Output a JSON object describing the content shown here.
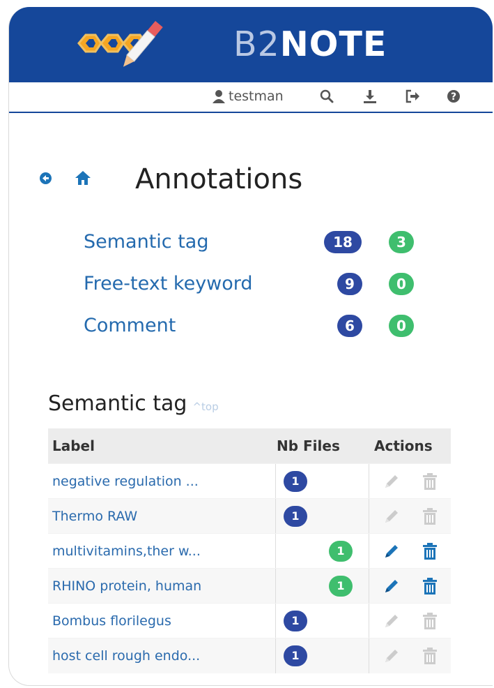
{
  "app": {
    "brand_prefix": "B2",
    "brand_suffix": "NOTE",
    "colors": {
      "header": "#15479a",
      "link": "#246aae",
      "badge_blue": "#2e49a2",
      "badge_green": "#3fbe6e",
      "action_active": "#1c74b8",
      "action_disabled": "#cccccc"
    }
  },
  "userbar": {
    "username": "testman",
    "icons": [
      "user-icon",
      "search-icon",
      "download-icon",
      "logout-icon",
      "help-icon"
    ]
  },
  "page": {
    "title": "Annotations",
    "nav_icons": [
      "back-circle-icon",
      "home-icon"
    ]
  },
  "summary": [
    {
      "label": "Semantic tag",
      "count_blue": "18",
      "count_green": "3"
    },
    {
      "label": "Free-text keyword",
      "count_blue": "9",
      "count_green": "0"
    },
    {
      "label": "Comment",
      "count_blue": "6",
      "count_green": "0"
    }
  ],
  "semantic_section": {
    "title": "Semantic tag",
    "top_link": "^top",
    "columns": {
      "label": "Label",
      "nb_files": "Nb Files",
      "actions": "Actions"
    },
    "rows": [
      {
        "label": "negative regulation ...",
        "files": "1",
        "badge": "blue",
        "editable": false
      },
      {
        "label": "Thermo RAW",
        "files": "1",
        "badge": "blue",
        "editable": false
      },
      {
        "label": "multivitamins,ther w...",
        "files": "1",
        "badge": "green",
        "editable": true
      },
      {
        "label": "RHINO protein, human",
        "files": "1",
        "badge": "green",
        "editable": true
      },
      {
        "label": "Bombus florilegus",
        "files": "1",
        "badge": "blue",
        "editable": false
      },
      {
        "label": "host cell rough endo...",
        "files": "1",
        "badge": "blue",
        "editable": false
      }
    ]
  }
}
